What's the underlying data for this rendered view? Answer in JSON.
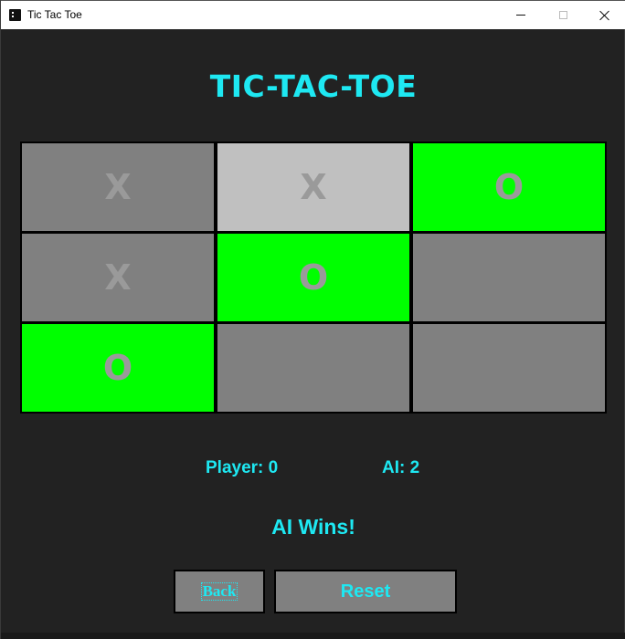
{
  "window": {
    "title": "Tic Tac Toe",
    "controls": [
      "minimize",
      "maximize",
      "close"
    ]
  },
  "heading": "TIC-TAC-TOE",
  "colors": {
    "background": "#222222",
    "accent_text": "#1ee8f2",
    "cell_empty": "#808080",
    "cell_last_move": "#c0c0c0",
    "cell_winning": "#00ff00",
    "mark_text": "#9a9a9a"
  },
  "board": {
    "cells": [
      {
        "row": 0,
        "col": 0,
        "mark": "X",
        "state": "normal"
      },
      {
        "row": 0,
        "col": 1,
        "mark": "X",
        "state": "highlighted"
      },
      {
        "row": 0,
        "col": 2,
        "mark": "O",
        "state": "winning"
      },
      {
        "row": 1,
        "col": 0,
        "mark": "X",
        "state": "normal"
      },
      {
        "row": 1,
        "col": 1,
        "mark": "O",
        "state": "winning"
      },
      {
        "row": 1,
        "col": 2,
        "mark": "",
        "state": "normal"
      },
      {
        "row": 2,
        "col": 0,
        "mark": "O",
        "state": "winning"
      },
      {
        "row": 2,
        "col": 1,
        "mark": "",
        "state": "normal"
      },
      {
        "row": 2,
        "col": 2,
        "mark": "",
        "state": "normal"
      }
    ]
  },
  "scores": {
    "player_label": "Player: 0",
    "ai_label": "AI: 2"
  },
  "status": "AI Wins!",
  "buttons": {
    "back_label": "Back",
    "reset_label": "Reset"
  }
}
